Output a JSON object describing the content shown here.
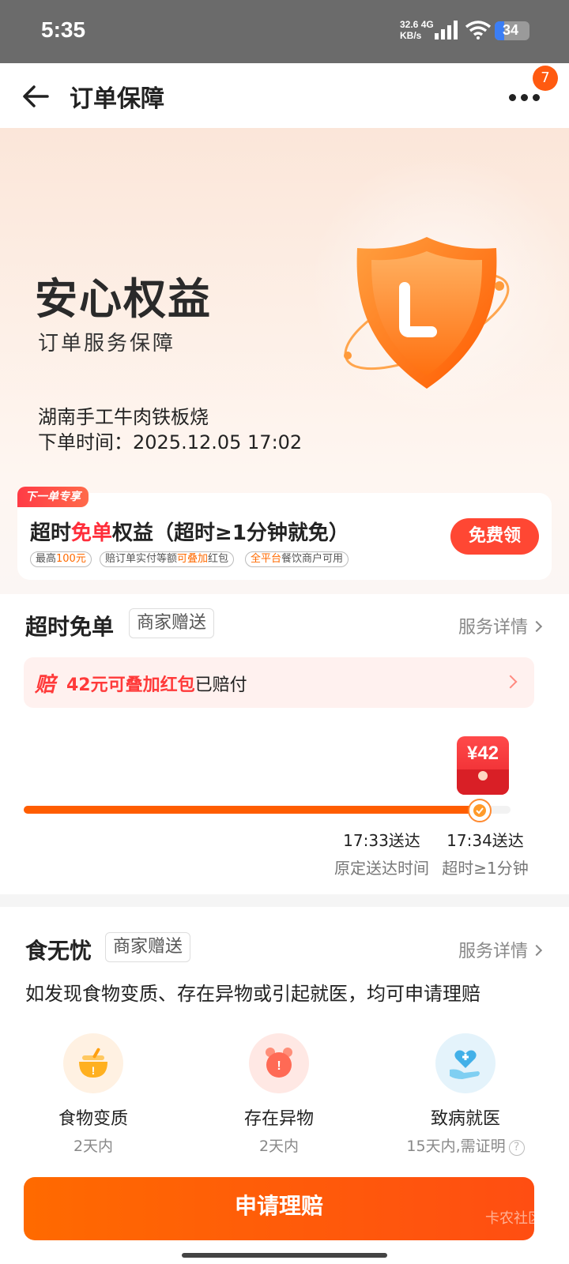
{
  "status": {
    "time": "5:35",
    "net_speed": "32.6",
    "net_unit": "KB/s",
    "net_type": "4G",
    "battery": "34"
  },
  "nav": {
    "title": "订单保障",
    "badge": "7"
  },
  "hero": {
    "title": "安心权益",
    "subtitle": "订单服务保障",
    "shop_name": "湖南手工牛肉铁板烧",
    "order_time": "下单时间：2025.12.05 17:02"
  },
  "coupon": {
    "tag": "下一单专享",
    "title_pre": "超时",
    "title_red": "免单",
    "title_post": "权益（超时≥1分钟就免）",
    "chip1_pre": "最高",
    "chip1_hl": "100元",
    "chip2_pre": "赔订单实付等额",
    "chip2_hl": "可叠加",
    "chip2_post": "红包",
    "chip3_hl": "全平台",
    "chip3_post": "餐饮商户可用",
    "button": "免费领"
  },
  "overtime": {
    "title": "超时免单",
    "tag": "商家赠送",
    "detail": "服务详情",
    "banner_pei": "赔",
    "banner_amount": "42元可叠加红包",
    "banner_status": "已赔付",
    "redpack": "¥42",
    "progress": 0.93,
    "planned_time": "17:33送达",
    "planned_desc": "原定送达时间",
    "actual_time": "17:34送达",
    "actual_desc": "超时≥1分钟"
  },
  "food_safety": {
    "title": "食无忧",
    "tag": "商家赠送",
    "detail": "服务详情",
    "desc": "如发现食物变质、存在异物或引起就医，均可申请理赔",
    "items": [
      {
        "label": "食物变质",
        "sub": "2天内",
        "icon": "bowl-icon"
      },
      {
        "label": "存在异物",
        "sub": "2天内",
        "icon": "alarm-clock-icon"
      },
      {
        "label": "致病就医",
        "sub": "15天内,需证明",
        "icon": "medical-hand-icon"
      }
    ],
    "help": "?"
  },
  "apply_button": "申请理赔",
  "watermark": "卡农社区",
  "colors": {
    "accent": "#ff5d00",
    "red": "#ff3a3a",
    "brand_orange": "#ff6a00"
  }
}
